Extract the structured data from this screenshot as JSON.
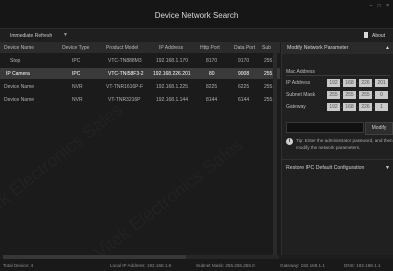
{
  "window": {
    "title": "Device Network Search",
    "controls": [
      "–",
      "□",
      "×"
    ]
  },
  "toolbar": {
    "refresh_label": "Immediate Refresh",
    "refresh_caret": "▼",
    "about_label": "About"
  },
  "table": {
    "columns": [
      "Device Name",
      "Device Type",
      "Product Model",
      "IP Address",
      "Http Port",
      "Data Port",
      "Sub"
    ],
    "rows": [
      {
        "name": "Stop",
        "type": "IPC",
        "model": "VTC-TN888M3",
        "ip": "192.168.1.170",
        "http": "8170",
        "data": "9170",
        "sub": "255."
      },
      {
        "name": "IP Camera",
        "type": "IPC",
        "model": "VTC-TNI58F3-2",
        "ip": "192.168.226.201",
        "http": "80",
        "data": "9008",
        "sub": "255."
      },
      {
        "name": "Device Name",
        "type": "NVR",
        "model": "VT-TNR1616P-F",
        "ip": "192.168.1.225",
        "http": "8225",
        "data": "6225",
        "sub": "255."
      },
      {
        "name": "Device Name",
        "type": "NVR",
        "model": "VT-TNR3216P",
        "ip": "192.168.1.144",
        "http": "8144",
        "data": "6144",
        "sub": "255."
      }
    ],
    "selected_index": 1
  },
  "panel": {
    "title": "Modify Network Parameter",
    "title_caret": "▲",
    "mac_label": "Mac Address",
    "ip_label": "IP Address",
    "ip_octets": [
      "192",
      "168",
      "226",
      "201"
    ],
    "subnet_label": "Subnet Mask",
    "subnet_octets": [
      "255",
      "255",
      "255",
      "0"
    ],
    "gateway_label": "Gateway",
    "gateway_octets": [
      "192",
      "168",
      "226",
      "1"
    ],
    "modify_label": "Modify",
    "tip_icon": "i",
    "tip_text": "Tip: Enter the administrator password, and then modify the network parameters.",
    "restore_label": "Restore IPC Default Configuration",
    "restore_caret": "▼"
  },
  "watermark": {
    "text": "Vitek Electronics Sales"
  },
  "status": {
    "total": "Total Device: 4",
    "local_ip": "Local IP Address: 192.168.1.6",
    "subnet": "Subnet Mask: 255.255.255.0",
    "gateway": "Gateway: 192.168.1.1",
    "dns": "DNS: 192.168.1.1"
  }
}
